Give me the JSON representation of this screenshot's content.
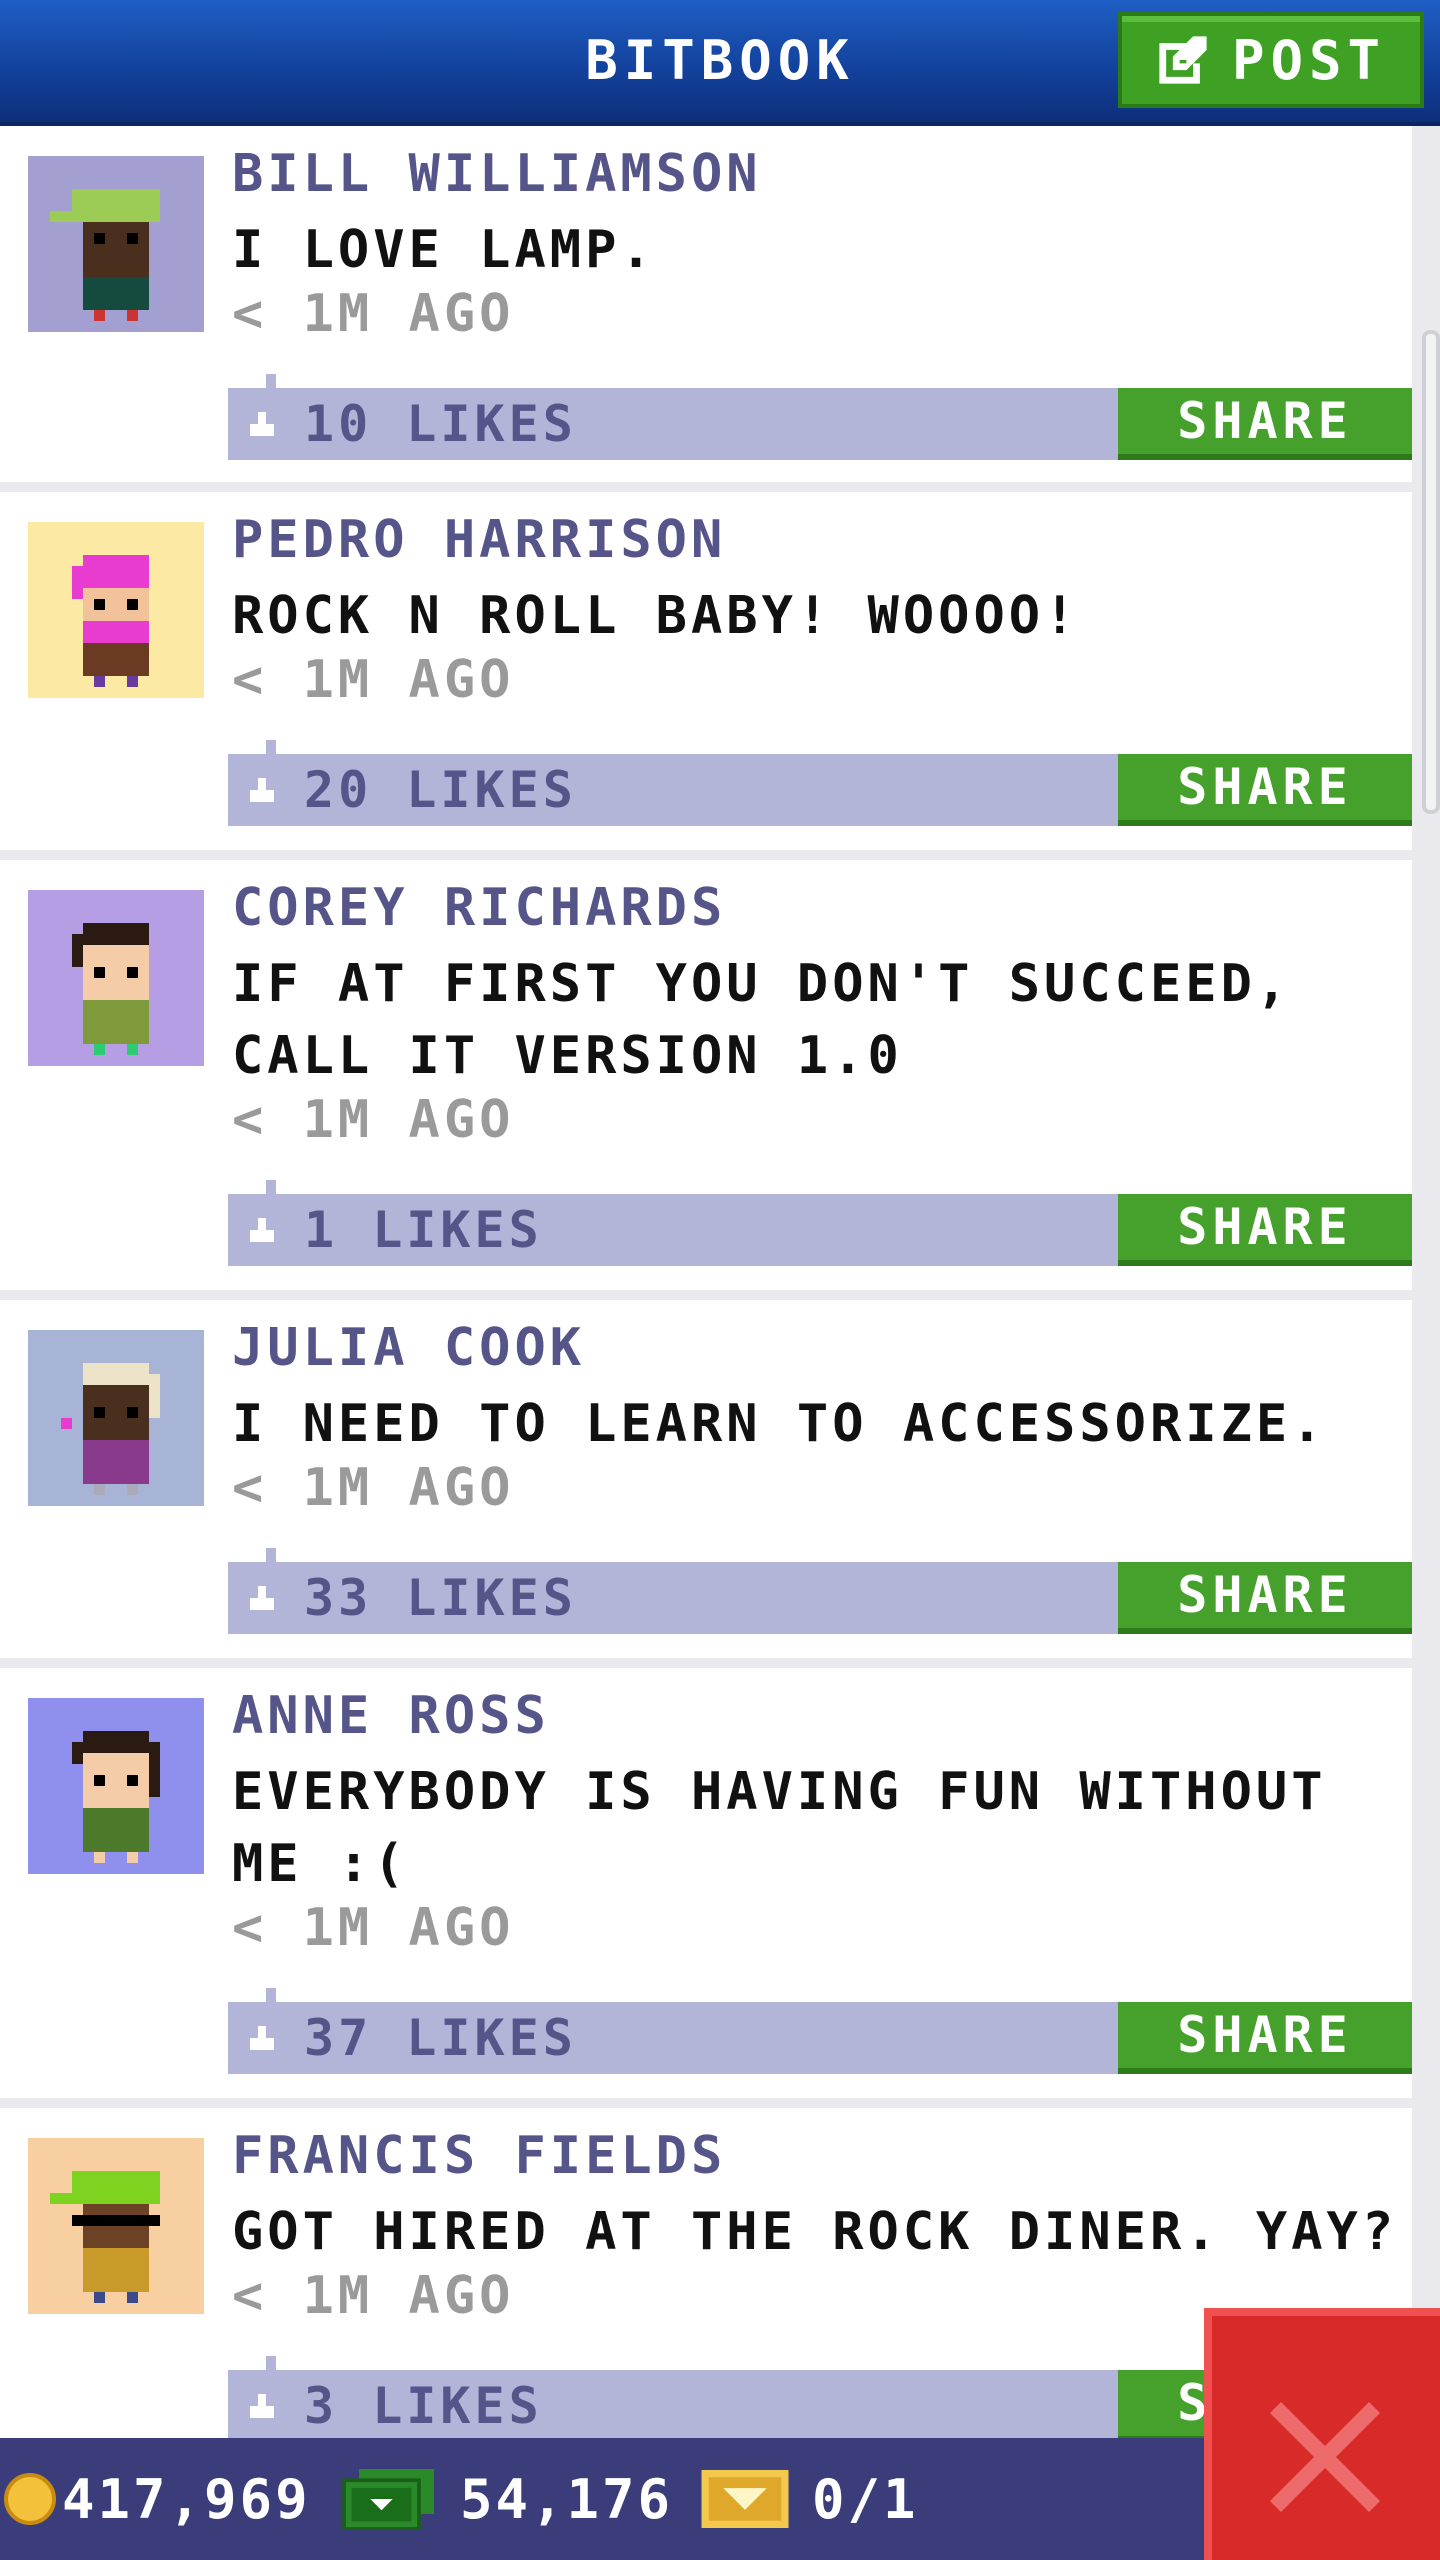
{
  "header": {
    "title": "BITBOOK",
    "post_label": "POST"
  },
  "posts": [
    {
      "name": "BILL WILLIAMSON",
      "message": "I LOVE LAMP.",
      "time": "< 1M AGO",
      "likes": "10 LIKES",
      "share": "SHARE",
      "avatar_bg": "#a39fd0"
    },
    {
      "name": "PEDRO HARRISON",
      "message": "ROCK N ROLL BABY! WOOOO!",
      "time": "< 1M AGO",
      "likes": "20 LIKES",
      "share": "SHARE",
      "avatar_bg": "#fbe9a4"
    },
    {
      "name": "COREY RICHARDS",
      "message": "IF AT FIRST YOU DON'T SUCCEED, CALL IT VERSION 1.0",
      "time": "< 1M AGO",
      "likes": "1 LIKES",
      "share": "SHARE",
      "avatar_bg": "#b59ee4"
    },
    {
      "name": "JULIA COOK",
      "message": "I NEED TO LEARN TO ACCESSORIZE.",
      "time": "< 1M AGO",
      "likes": "33 LIKES",
      "share": "SHARE",
      "avatar_bg": "#a8b4d6"
    },
    {
      "name": "ANNE ROSS",
      "message": "EVERYBODY IS HAVING FUN WITHOUT ME :(",
      "time": "< 1M AGO",
      "likes": "37 LIKES",
      "share": "SHARE",
      "avatar_bg": "#8f90ee"
    },
    {
      "name": "FRANCIS FIELDS",
      "message": "GOT HIRED AT THE ROCK DINER. YAY?",
      "time": "< 1M AGO",
      "likes": "3 LIKES",
      "share": "SHARE",
      "avatar_bg": "#f8cfa0"
    }
  ],
  "status": {
    "coins": "417,969",
    "bux": "54,176",
    "tickets": "0/1"
  },
  "colors": {
    "header": "#1646a8",
    "accent_green": "#45a02c",
    "likes_bar": "#b3b5d8",
    "status_bar": "#3a3d7a",
    "close": "#d92a2a"
  },
  "icons": [
    "post-edit-icon",
    "like-icon",
    "coin-icon",
    "bux-icon",
    "ticket-icon",
    "close-icon"
  ]
}
